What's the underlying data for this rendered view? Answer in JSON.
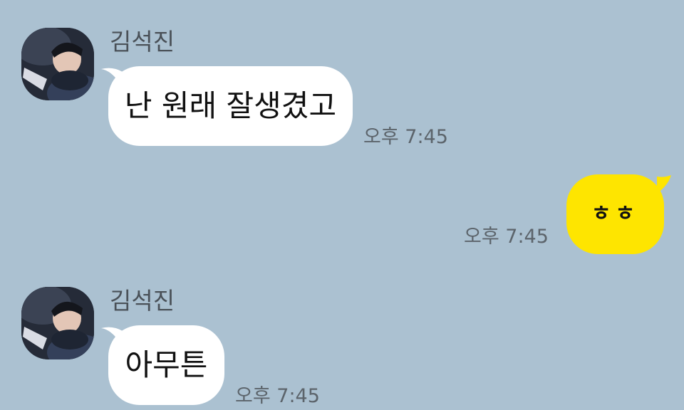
{
  "theme": {
    "background": "#abc1d1",
    "incoming_bubble": "#ffffff",
    "outgoing_bubble": "#fee500"
  },
  "messages": [
    {
      "direction": "incoming",
      "sender": "김석진",
      "avatar": "profile-photo",
      "text": "난 원래 잘생겼고",
      "time": "오후 7:45"
    },
    {
      "direction": "outgoing",
      "text": "ㅎㅎ",
      "time": "오후 7:45"
    },
    {
      "direction": "incoming",
      "sender": "김석진",
      "avatar": "profile-photo",
      "text": "아무튼",
      "time": "오후 7:45"
    }
  ]
}
